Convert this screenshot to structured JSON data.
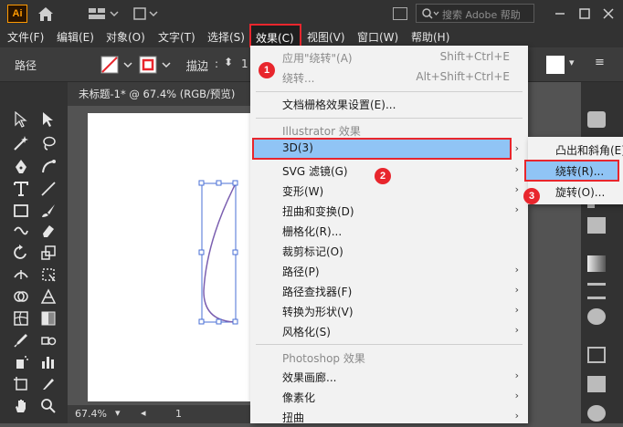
{
  "app": {
    "logo_text": "Ai"
  },
  "search": {
    "placeholder": "搜索 Adobe 帮助"
  },
  "menubar": {
    "items": [
      "文件(F)",
      "编辑(E)",
      "对象(O)",
      "文字(T)",
      "选择(S)",
      "效果(C)",
      "视图(V)",
      "窗口(W)",
      "帮助(H)"
    ]
  },
  "controlbar": {
    "path_label": "路径",
    "stroke_label": "描边",
    "stroke_value": "1"
  },
  "document": {
    "tab_label": "未标题-1* @ 67.4% (RGB/预览)",
    "close": "×",
    "zoom": "67.4%",
    "page": "1"
  },
  "effect_menu": {
    "apply_label": "应用\"绕转\"(A)",
    "apply_shortcut": "Shift+Ctrl+E",
    "redo_label": "绕转...",
    "redo_shortcut": "Alt+Shift+Ctrl+E",
    "raster_settings": "文档栅格效果设置(E)...",
    "illustrator_section": "Illustrator 效果",
    "items": [
      "3D(3)",
      "SVG 滤镜(G)",
      "变形(W)",
      "扭曲和变换(D)",
      "栅格化(R)...",
      "裁剪标记(O)",
      "路径(P)",
      "路径查找器(F)",
      "转换为形状(V)",
      "风格化(S)"
    ],
    "photoshop_section": "Photoshop 效果",
    "ps_items": [
      "效果画廊...",
      "像素化",
      "扭曲"
    ]
  },
  "submenu_3d": {
    "items": [
      "凸出和斜角(E)...",
      "绕转(R)...",
      "旋转(O)..."
    ]
  },
  "badges": [
    "1",
    "2",
    "3"
  ],
  "colors": {
    "highlight": "#90c4f5",
    "annotation_red": "#e8262d",
    "path_purple": "#7b5fb0",
    "selection_blue": "#4a6fd6"
  }
}
